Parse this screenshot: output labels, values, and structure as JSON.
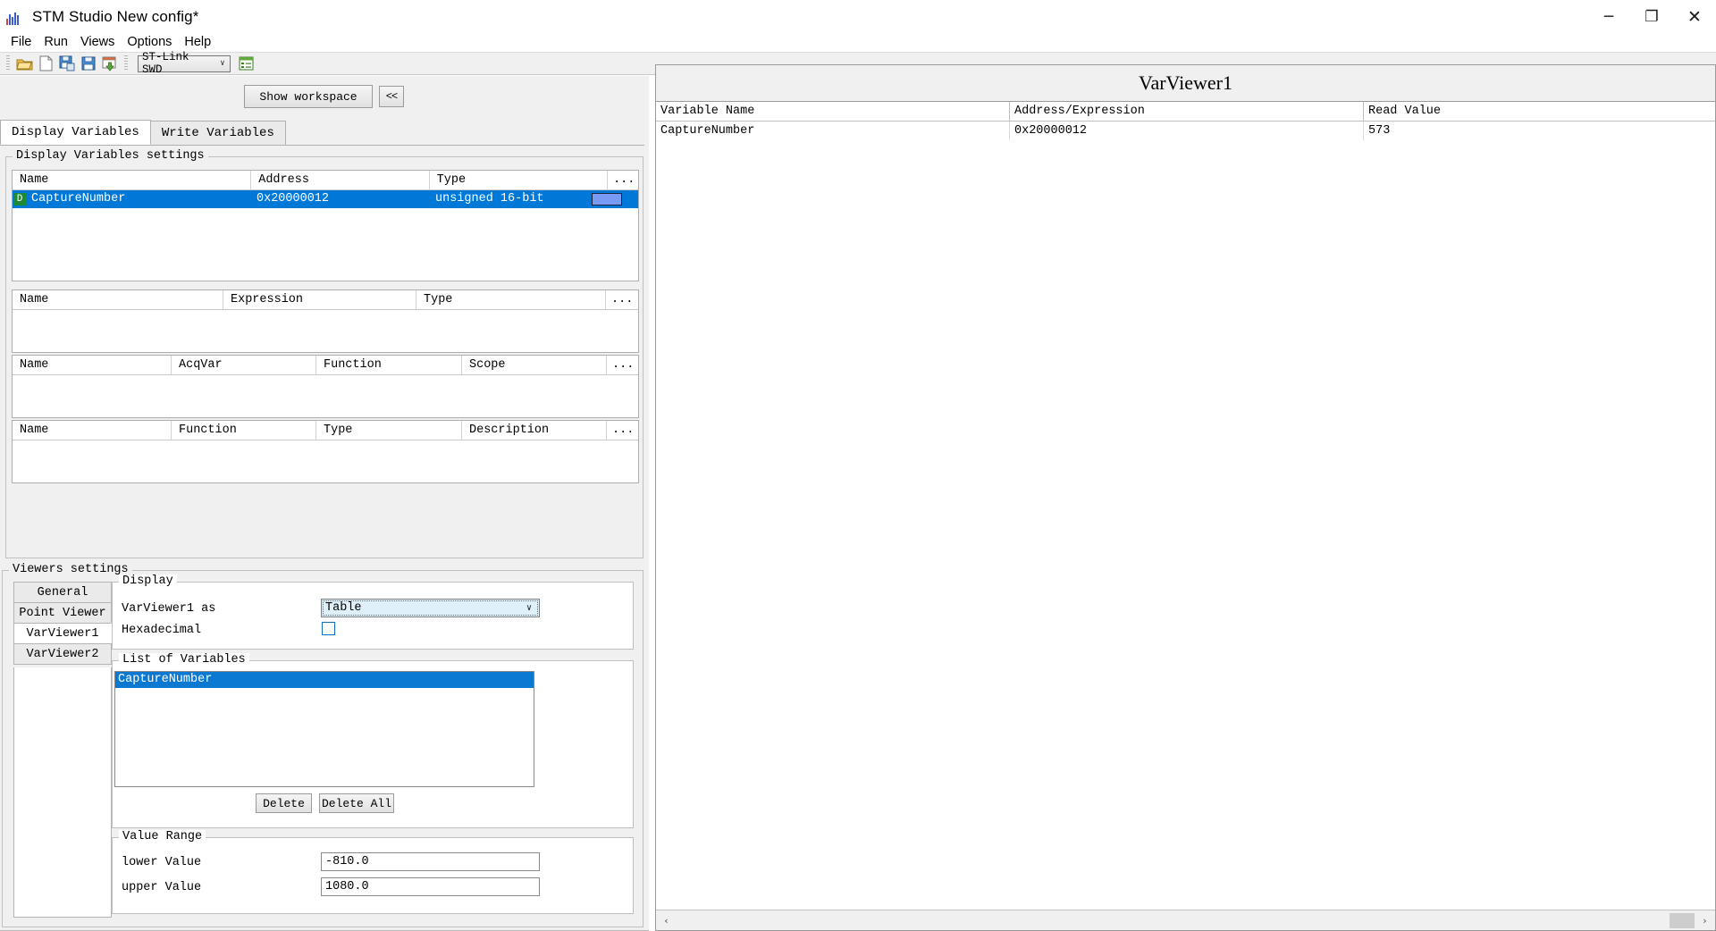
{
  "window": {
    "title": "STM Studio New config*",
    "logo_icon": "bar-chart-logo-icon",
    "minimize_icon": "minimize-icon",
    "maximize_icon": "maximize-icon",
    "close_icon": "close-icon",
    "minimize_glyph": "─",
    "maximize_glyph": "❐",
    "close_glyph": "✕"
  },
  "menubar": {
    "items": [
      {
        "label": "File"
      },
      {
        "label": "Run"
      },
      {
        "label": "Views"
      },
      {
        "label": "Options"
      },
      {
        "label": "Help"
      }
    ]
  },
  "toolbar": {
    "icons": [
      {
        "name": "open-folder-icon"
      },
      {
        "name": "new-file-icon"
      },
      {
        "name": "save-as-icon"
      },
      {
        "name": "save-icon"
      },
      {
        "name": "import-icon"
      }
    ],
    "connection": {
      "value": "ST-Link SWD",
      "arrow_glyph": "∨"
    },
    "settings_icon": "target-settings-icon"
  },
  "left_panel": {
    "show_workspace_label": "Show workspace",
    "collapse_label": "<<",
    "tabs": [
      {
        "label": "Display Variables",
        "active": true
      },
      {
        "label": "Write Variables",
        "active": false
      }
    ],
    "display_settings_legend": "Display Variables settings",
    "tables": [
      {
        "name": "variables-table",
        "columns": [
          "Name",
          "Address",
          "Type",
          "..."
        ],
        "rows": [
          {
            "badge": "D",
            "name": "CaptureNumber",
            "address": "0x20000012",
            "type": "unsigned 16-bit",
            "color": "#7a9bf5",
            "selected": true
          }
        ]
      },
      {
        "name": "expressions-table",
        "columns": [
          "Name",
          "Expression",
          "Type",
          "..."
        ],
        "rows": []
      },
      {
        "name": "acqvar-table",
        "columns": [
          "Name",
          "AcqVar",
          "Function",
          "Scope",
          "..."
        ],
        "rows": []
      },
      {
        "name": "functions-table",
        "columns": [
          "Name",
          "Function",
          "Type",
          "Description",
          "..."
        ],
        "rows": []
      }
    ]
  },
  "viewers": {
    "legend": "Viewers settings",
    "side_tabs": [
      {
        "label": "General",
        "active": false
      },
      {
        "label": "Point Viewer",
        "active": false
      },
      {
        "label": "VarViewer1",
        "active": true
      },
      {
        "label": "VarViewer2",
        "active": false
      }
    ],
    "display_group": {
      "legend": "Display",
      "as_label": "VarViewer1 as",
      "as_value": "Table",
      "as_arrow": "∨",
      "hex_label": "Hexadecimal",
      "hex_checked": false
    },
    "variables_group": {
      "legend": "List of Variables",
      "items": [
        {
          "label": "CaptureNumber",
          "selected": true
        }
      ],
      "delete_label": "Delete",
      "delete_all_label": "Delete All"
    },
    "value_range": {
      "legend": "Value Range",
      "lower_label": "lower Value",
      "lower_value": "-810.0",
      "upper_label": "upper Value",
      "upper_value": "1080.0"
    }
  },
  "var_viewer": {
    "title": "VarViewer1",
    "columns": [
      "Variable Name",
      "Address/Expression",
      "Read Value"
    ],
    "rows": [
      {
        "variable_name": "CaptureNumber",
        "address": "0x20000012",
        "read_value": "573"
      }
    ],
    "scroll_left_glyph": "‹",
    "scroll_right_glyph": "›"
  },
  "colors": {
    "selection_blue": "#0078d7",
    "badge_green": "#1d8a34",
    "swatch": "#7a9bf5",
    "panel_bg": "#f0f0f0"
  }
}
